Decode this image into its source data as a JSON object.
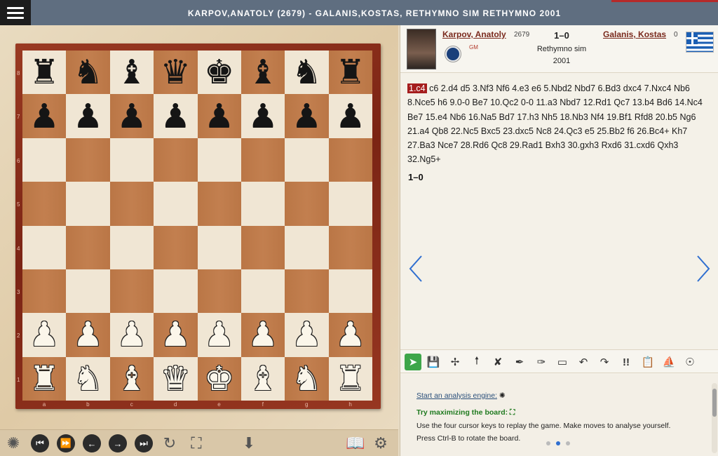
{
  "header": {
    "title": "KARPOV,ANATOLY (2679) - GALANIS,KOSTAS, RETHYMNO SIM RETHYMNO 2001"
  },
  "board": {
    "rank_labels": [
      "8",
      "7",
      "6",
      "5",
      "4",
      "3",
      "2",
      "1"
    ],
    "file_labels": [
      "a",
      "b",
      "c",
      "d",
      "e",
      "f",
      "g",
      "h"
    ],
    "squares": [
      [
        "br",
        "bn",
        "bb",
        "bq",
        "bk",
        "bb",
        "bn",
        "br"
      ],
      [
        "bp",
        "bp",
        "bp",
        "bp",
        "bp",
        "bp",
        "bp",
        "bp"
      ],
      [
        "",
        "",
        "",
        "",
        "",
        "",
        "",
        ""
      ],
      [
        "",
        "",
        "",
        "",
        "",
        "",
        "",
        ""
      ],
      [
        "",
        "",
        "",
        "",
        "",
        "",
        "",
        ""
      ],
      [
        "",
        "",
        "",
        "",
        "",
        "",
        "",
        ""
      ],
      [
        "wp",
        "wp",
        "wp",
        "wp",
        "wp",
        "wp",
        "wp",
        "wp"
      ],
      [
        "wr",
        "wn",
        "wb",
        "wq",
        "wk",
        "wb",
        "wn",
        "wr"
      ]
    ],
    "colors": {
      "light": "#f0e6d4",
      "dark": "#c07a48",
      "frame": "#8b2d1c"
    }
  },
  "players": {
    "white": {
      "name": "Karpov, Anatoly",
      "elo": "2679",
      "title": "GM"
    },
    "black": {
      "name": "Galanis, Kostas",
      "elo": "0",
      "flag": "greece-flag"
    },
    "result": "1–0",
    "event": "Rethymno sim",
    "year": "2001"
  },
  "moves": {
    "highlighted_move": "1.c4",
    "text": " c6 2.d4 d5 3.Nf3 Nf6 4.e3 e6 5.Nbd2 Nbd7 6.Bd3 dxc4 7.Nxc4 Nb6 8.Nce5 h6 9.0-0 Be7 10.Qc2 0-0 11.a3 Nbd7 12.Rd1 Qc7 13.b4 Bd6 14.Nc4 Be7 15.e4 Nb6 16.Na5 Bd7 17.h3 Nh5 18.Nb3 Nf4 19.Bf1 Rfd8 20.b5 Ng6 21.a4 Qb8 22.Nc5 Bxc5 23.dxc5 Nc8 24.Qc3 e5 25.Bb2 f6 26.Bc4+ Kh7 27.Ba3 Nce7 28.Rd6 Qc8 29.Rad1 Bxh3 30.gxh3 Rxd6 31.cxd6 Qxh3 32.Ng5+",
    "final_result": "1–0"
  },
  "info": {
    "engine_link": "Start an analysis engine:",
    "maximize_title": "Try maximizing the board:",
    "line1": "Use the four cursor keys to replay the game. Make moves to analyse yourself.",
    "line2": "Press Ctrl-B to rotate the board."
  },
  "toolbar_actions": [
    "share-icon",
    "save-icon",
    "move-arrows-icon",
    "up-arrow-icon",
    "no-engine-icon",
    "pen-icon",
    "pen-fine-icon",
    "eraser-icon",
    "undo-icon",
    "redo-icon",
    "annotation-icon",
    "clipboard-icon",
    "boat-icon",
    "help-icon"
  ],
  "accent_color": "#a51d1d"
}
